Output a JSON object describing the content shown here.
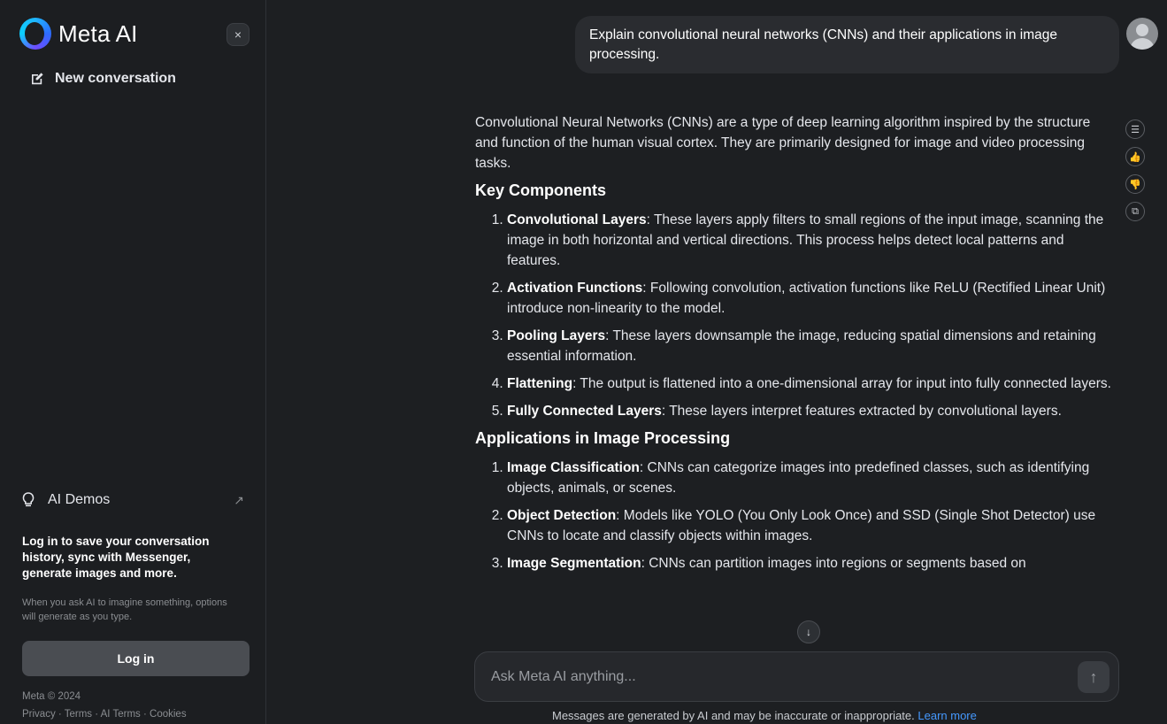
{
  "sidebar": {
    "brand": "Meta AI",
    "close_icon": "×",
    "new_conversation": "New conversation",
    "demos_label": "AI Demos",
    "demos_arrow": "↗",
    "login_heading": "Log in to save your conversation history, sync with Messenger, generate images and more.",
    "login_sub": "When you ask AI to imagine something, options will generate as you type.",
    "login_button": "Log in",
    "copyright": "Meta © 2024",
    "footer_links": [
      "Privacy",
      "Terms",
      "AI Terms",
      "Cookies"
    ],
    "footer_separator": " · "
  },
  "chat": {
    "user_message": "Explain convolutional neural networks (CNNs) and their applications in image processing.",
    "intro": "Convolutional Neural Networks (CNNs) are a type of deep learning algorithm inspired by the structure and function of the human visual cortex. They are primarily designed for image and video processing tasks.",
    "section1_title": "Key Components",
    "section1_items": [
      {
        "term": "Convolutional Layers",
        "text": ": These layers apply filters to small regions of the input image, scanning the image in both horizontal and vertical directions. This process helps detect local patterns and features."
      },
      {
        "term": "Activation Functions",
        "text": ": Following convolution, activation functions like ReLU (Rectified Linear Unit) introduce non-linearity to the model."
      },
      {
        "term": "Pooling Layers",
        "text": ": These layers downsample the image, reducing spatial dimensions and retaining essential information."
      },
      {
        "term": "Flattening",
        "text": ": The output is flattened into a one-dimensional array for input into fully connected layers."
      },
      {
        "term": "Fully Connected Layers",
        "text": ": These layers interpret features extracted by convolutional layers."
      }
    ],
    "section2_title": "Applications in Image Processing",
    "section2_items": [
      {
        "term": "Image Classification",
        "text": ": CNNs can categorize images into predefined classes, such as identifying objects, animals, or scenes."
      },
      {
        "term": "Object Detection",
        "text": ": Models like YOLO (You Only Look Once) and SSD (Single Shot Detector) use CNNs to locate and classify objects within images."
      },
      {
        "term": "Image Segmentation",
        "text": ": CNNs can partition images into regions or segments based on"
      }
    ],
    "actions": [
      "tune-icon",
      "thumbs-up-icon",
      "thumbs-down-icon",
      "copy-icon"
    ],
    "scroll_down_icon": "↓"
  },
  "composer": {
    "placeholder": "Ask Meta AI anything...",
    "send_icon": "↑",
    "disclaimer": "Messages are generated by AI and may be inaccurate or inappropriate.",
    "learn_more": "Learn more"
  }
}
